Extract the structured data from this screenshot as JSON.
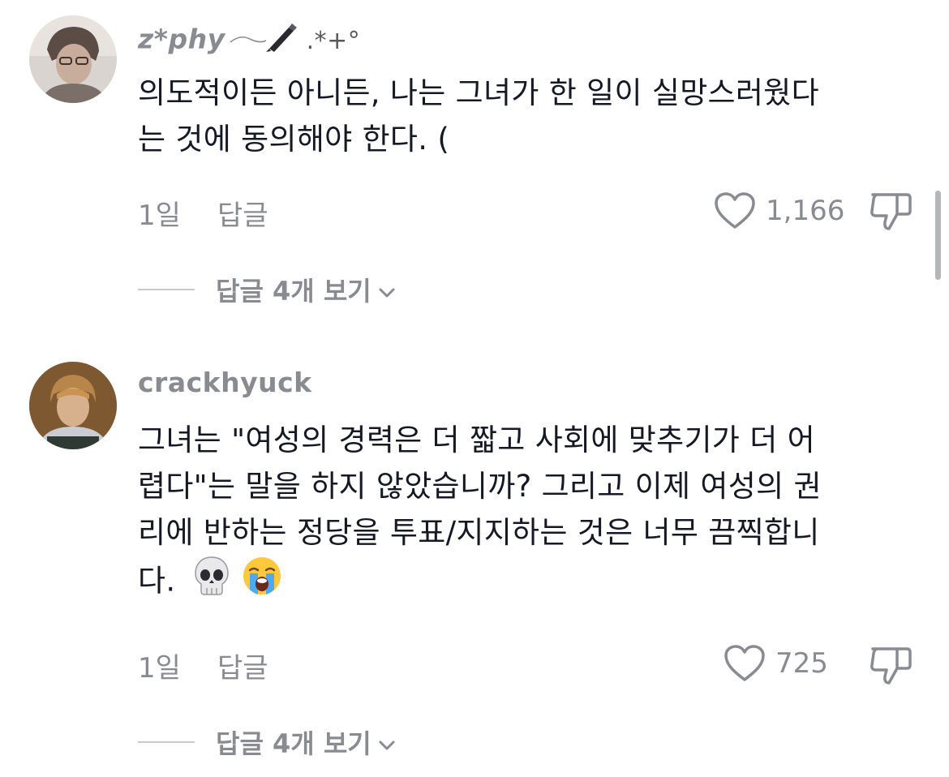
{
  "comments": [
    {
      "username": "z*phy",
      "username_suffix": ".*+°",
      "text_lines": [
        "의도적이든 아니든, 나는 그녀가 한 일이 실망스러웠다",
        "는 것에 동의해야 한다. ("
      ],
      "time": "1일",
      "reply_label": "답글",
      "likes": "1,166",
      "view_replies": "답글 4개 보기"
    },
    {
      "username": "crackhyuck",
      "text_lines": [
        "그녀는 \"여성의 경력은 더 짧고 사회에 맞추기가 더 어",
        "렵다\"는 말을 하지 않았습니까? 그리고 이제 여성의 권",
        "리에 반하는 정당을 투표/지지하는 것은 너무 끔찍합니",
        "다."
      ],
      "emojis": [
        "skull-emoji",
        "loudly-crying-face-emoji"
      ],
      "time": "1일",
      "reply_label": "답글",
      "likes": "725",
      "view_replies": "답글 4개 보기"
    }
  ],
  "icons": {
    "like": "heart-outline-icon",
    "dislike": "thumbs-down-outline-icon",
    "expand": "chevron-down-icon",
    "username_decoration": "pen-icon"
  },
  "colors": {
    "text": "#161823",
    "secondary": "#8a8b91",
    "background": "#ffffff"
  }
}
